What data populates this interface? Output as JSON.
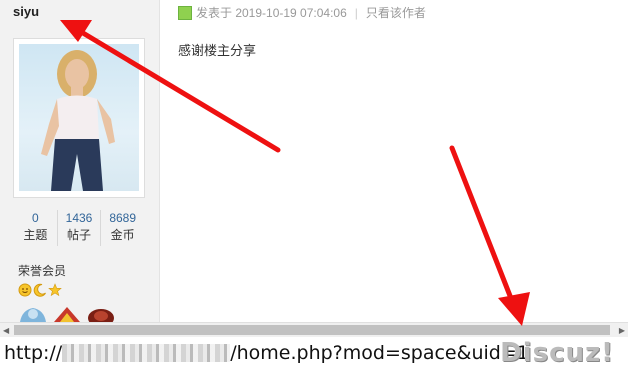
{
  "user": {
    "name": "siyu",
    "stats": [
      {
        "value": "0",
        "label": "主题"
      },
      {
        "value": "1436",
        "label": "帖子"
      },
      {
        "value": "8689",
        "label": "金币"
      }
    ],
    "group": "荣誉会员"
  },
  "post": {
    "meta": "发表于 2019-10-19 07:04:06",
    "separator": "|",
    "only_author": "只看该作者",
    "content": "感谢楼主分享"
  },
  "statusbar": {
    "url_prefix": "http://",
    "url_suffix": "/home.php?mod=space&uid=",
    "uid_partial": "1"
  },
  "watermark": "Discuz!",
  "colors": {
    "arrow": "#ee1111",
    "online": "#8fd14f",
    "stat_link": "#336699"
  }
}
